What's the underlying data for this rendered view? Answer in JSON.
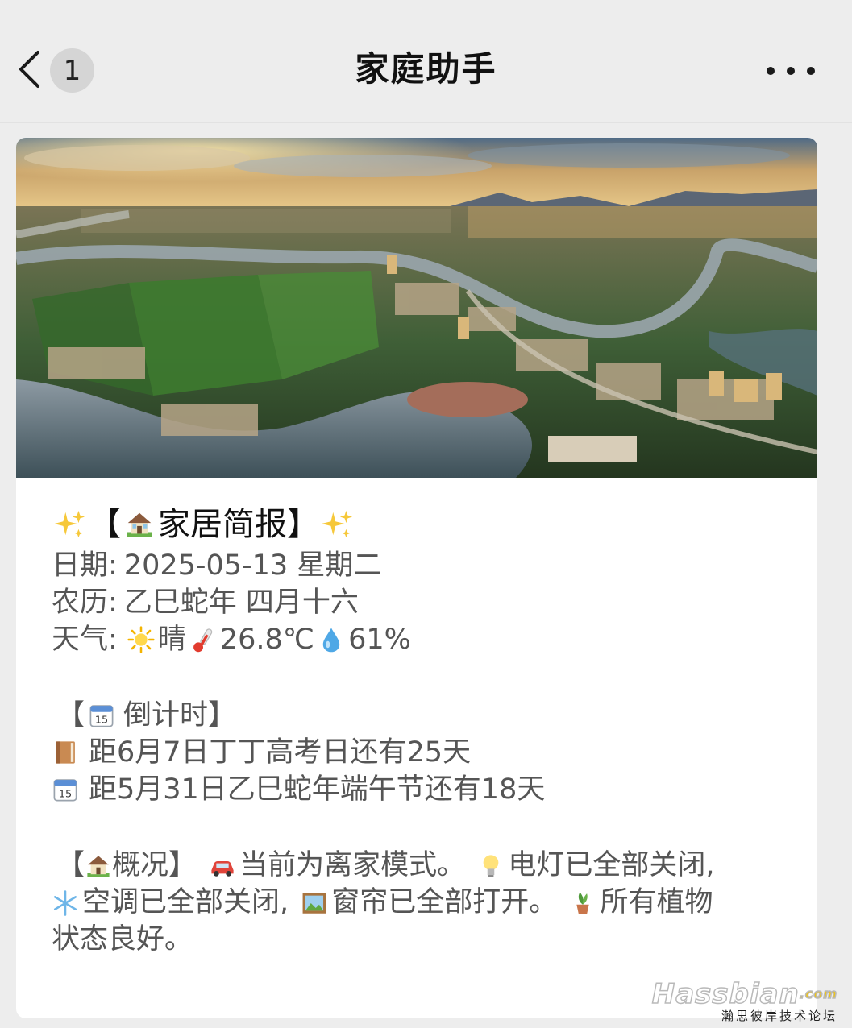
{
  "navbar": {
    "unread_count": "1",
    "title": "家庭助手"
  },
  "banner": {
    "icon": "aerial-city-river-photo"
  },
  "brief": {
    "title_prefix": "【",
    "title_text": "家居简报】",
    "date_label": "日期:",
    "date_value": "2025-05-13 星期二",
    "lunar_label": "农历:",
    "lunar_value": "乙巳蛇年 四月十六",
    "weather_label": "天气:",
    "weather_condition": "晴",
    "temperature": "26.8℃",
    "humidity": "61%"
  },
  "countdown": {
    "head_open": "【",
    "head_text": "倒计时】",
    "items": [
      {
        "icon": "book-icon",
        "text": "距6月7日丁丁高考日还有25天"
      },
      {
        "icon": "calendar-icon",
        "text": "距5月31日乙巳蛇年端午节还有18天"
      }
    ]
  },
  "overview": {
    "head_open": "【",
    "head_text": "概况】",
    "mode": "当前为离家模式。",
    "lights": "电灯已全部关闭,",
    "ac": "空调已全部关闭,",
    "curtains": "窗帘已全部打开。",
    "plants_1": "所有植物",
    "plants_2": "状态良好。"
  },
  "watermark": {
    "logo": "Hassbian",
    "com": ".com",
    "subtitle": "瀚思彼岸技术论坛"
  },
  "colors": {
    "page_bg": "#ededed",
    "card_bg": "#ffffff",
    "text_primary": "#111111",
    "text_secondary": "#555555"
  }
}
